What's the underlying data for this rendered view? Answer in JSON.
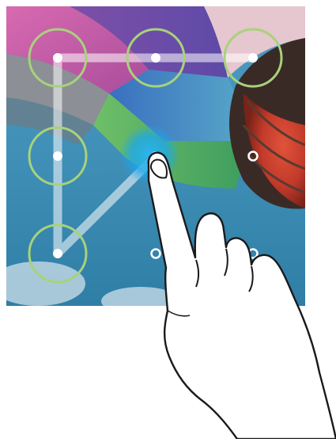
{
  "lock_screen": {
    "type": "pattern-unlock",
    "grid": {
      "rows": 3,
      "cols": 3
    },
    "selected_dots": [
      1,
      2,
      3,
      4,
      7
    ],
    "active_dot": 5,
    "pattern_path": [
      3,
      2,
      1,
      4,
      7,
      5
    ],
    "colors": {
      "ring": "#a8d27a",
      "line": "#ffffff",
      "glow": "#1aa7ee"
    },
    "icons": {
      "dots": "pattern-dot",
      "hand": "pointing-hand-icon"
    }
  }
}
